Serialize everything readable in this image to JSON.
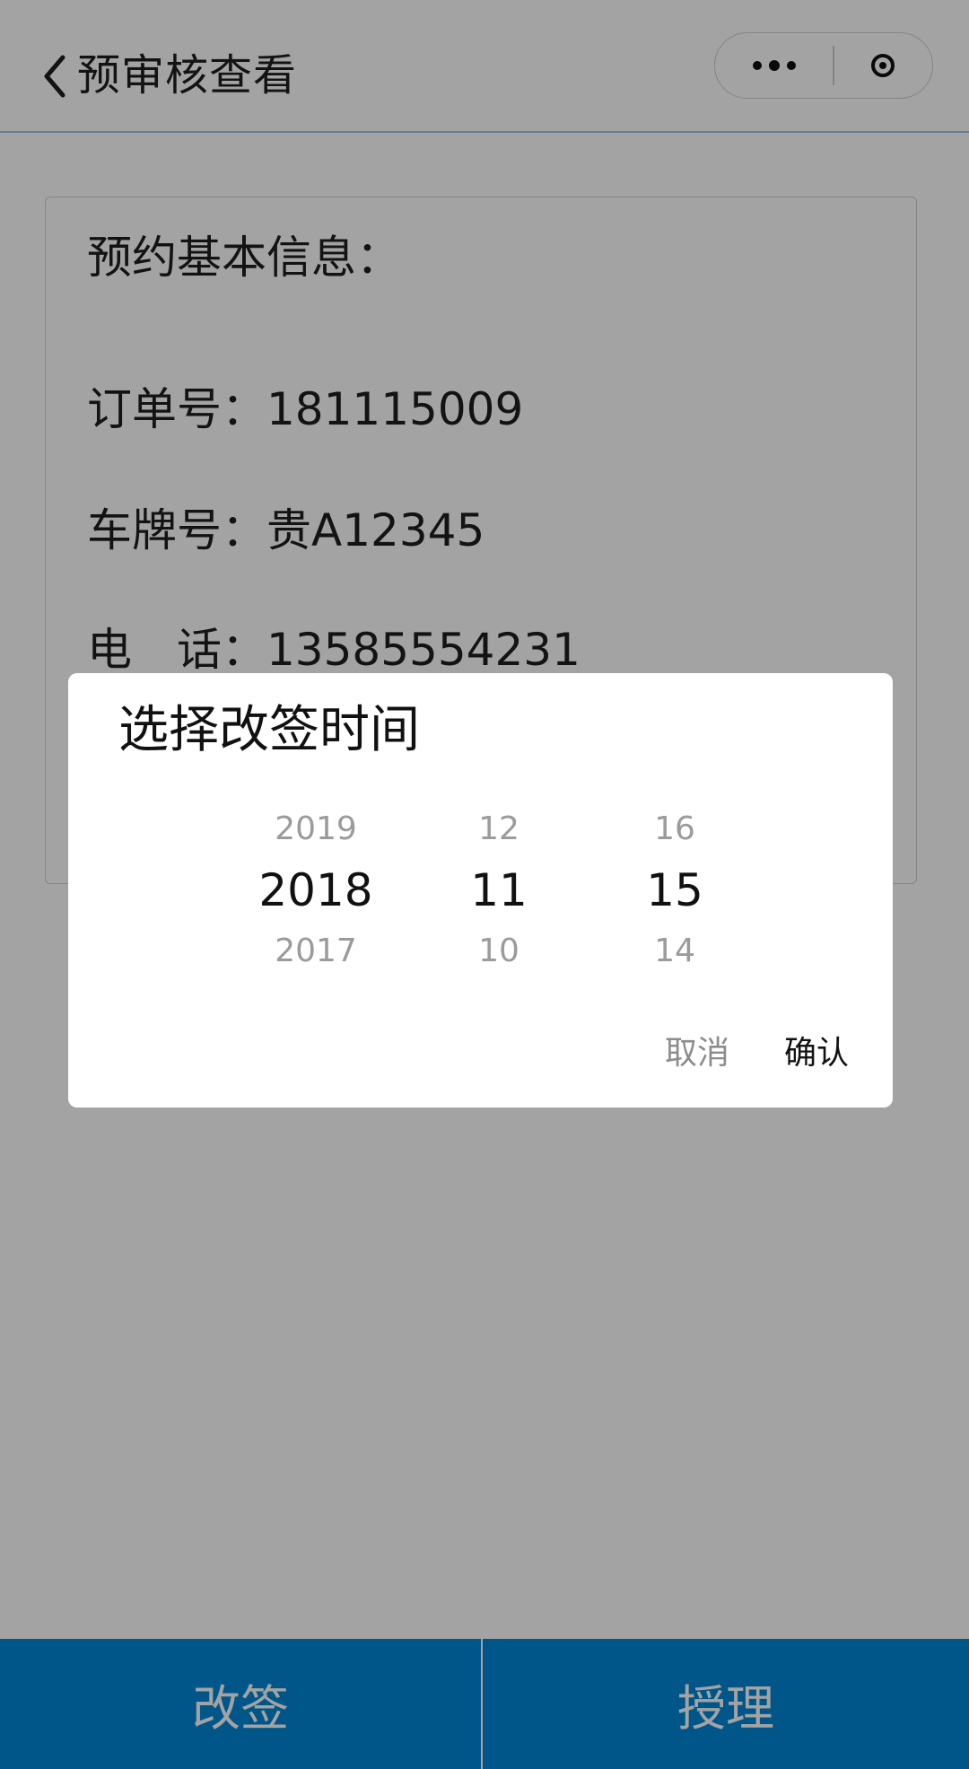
{
  "nav": {
    "title": "预审核查看",
    "back_icon": "chevron-left-icon",
    "more_icon": "more-dots-icon",
    "close_icon": "target-circle-icon"
  },
  "card": {
    "heading": "预约基本信息：",
    "order_label": "订单号：",
    "order_value": "181115009",
    "plate_label": "车牌号：",
    "plate_value": "贵A12345",
    "phone_label": "电　话：",
    "phone_value": "13585554231"
  },
  "dialog": {
    "title": "选择改签时间",
    "year": {
      "prev": "2019",
      "selected": "2018",
      "next": "2017"
    },
    "month": {
      "prev": "12",
      "selected": "11",
      "next": "10"
    },
    "day": {
      "prev": "16",
      "selected": "15",
      "next": "14"
    },
    "cancel_label": "取消",
    "confirm_label": "确认"
  },
  "footer": {
    "left_label": "改签",
    "right_label": "授理"
  },
  "colors": {
    "accent": "#0087d5",
    "nav_line": "#9ec7e6",
    "mask": "rgba(0,0,0,0.36)"
  }
}
